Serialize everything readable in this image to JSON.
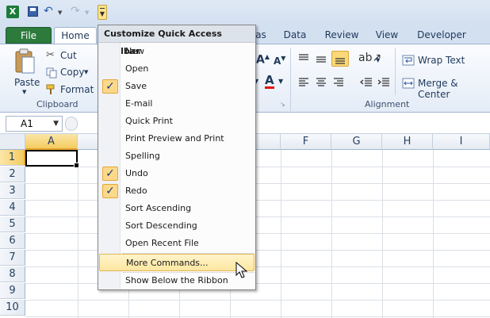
{
  "qat": {
    "app_icon": "X"
  },
  "tabs": [
    {
      "label": "File"
    },
    {
      "label": "Home"
    },
    {
      "label": "as"
    },
    {
      "label": "Data"
    },
    {
      "label": "Review"
    },
    {
      "label": "View"
    },
    {
      "label": "Developer"
    }
  ],
  "ribbon": {
    "paste": "Paste",
    "cut": "Cut",
    "copy": "Copy",
    "format_painter": "Format Pa",
    "clipboard_group": "Clipboard",
    "wrap_text": "Wrap Text",
    "merge_center": "Merge & Center",
    "alignment_group": "Alignment"
  },
  "formula_bar": {
    "name_box": "A1"
  },
  "grid": {
    "columns": [
      "A",
      "",
      "",
      "",
      "E",
      "F",
      "G",
      "H",
      "I"
    ],
    "rows": [
      "1",
      "2",
      "3",
      "4",
      "5",
      "6",
      "7",
      "8",
      "9",
      "10"
    ],
    "selected_cell": "A1"
  },
  "menu": {
    "title": "Customize Quick Access Toolbar",
    "items": [
      {
        "label": "New",
        "checked": false
      },
      {
        "label": "Open",
        "checked": false
      },
      {
        "label": "Save",
        "checked": true
      },
      {
        "label": "E-mail",
        "checked": false
      },
      {
        "label": "Quick Print",
        "checked": false
      },
      {
        "label": "Print Preview and Print",
        "checked": false
      },
      {
        "label": "Spelling",
        "checked": false
      },
      {
        "label": "Undo",
        "checked": true
      },
      {
        "label": "Redo",
        "checked": true
      },
      {
        "label": "Sort Ascending",
        "checked": false
      },
      {
        "label": "Sort Descending",
        "checked": false
      },
      {
        "label": "Open Recent File",
        "checked": false
      }
    ],
    "more_commands": "More Commands...",
    "show_below": "Show Below the Ribbon",
    "check_glyph": "✓"
  },
  "colors": {
    "accent": "#fcd98a",
    "file_tab": "#2c7a3c"
  }
}
